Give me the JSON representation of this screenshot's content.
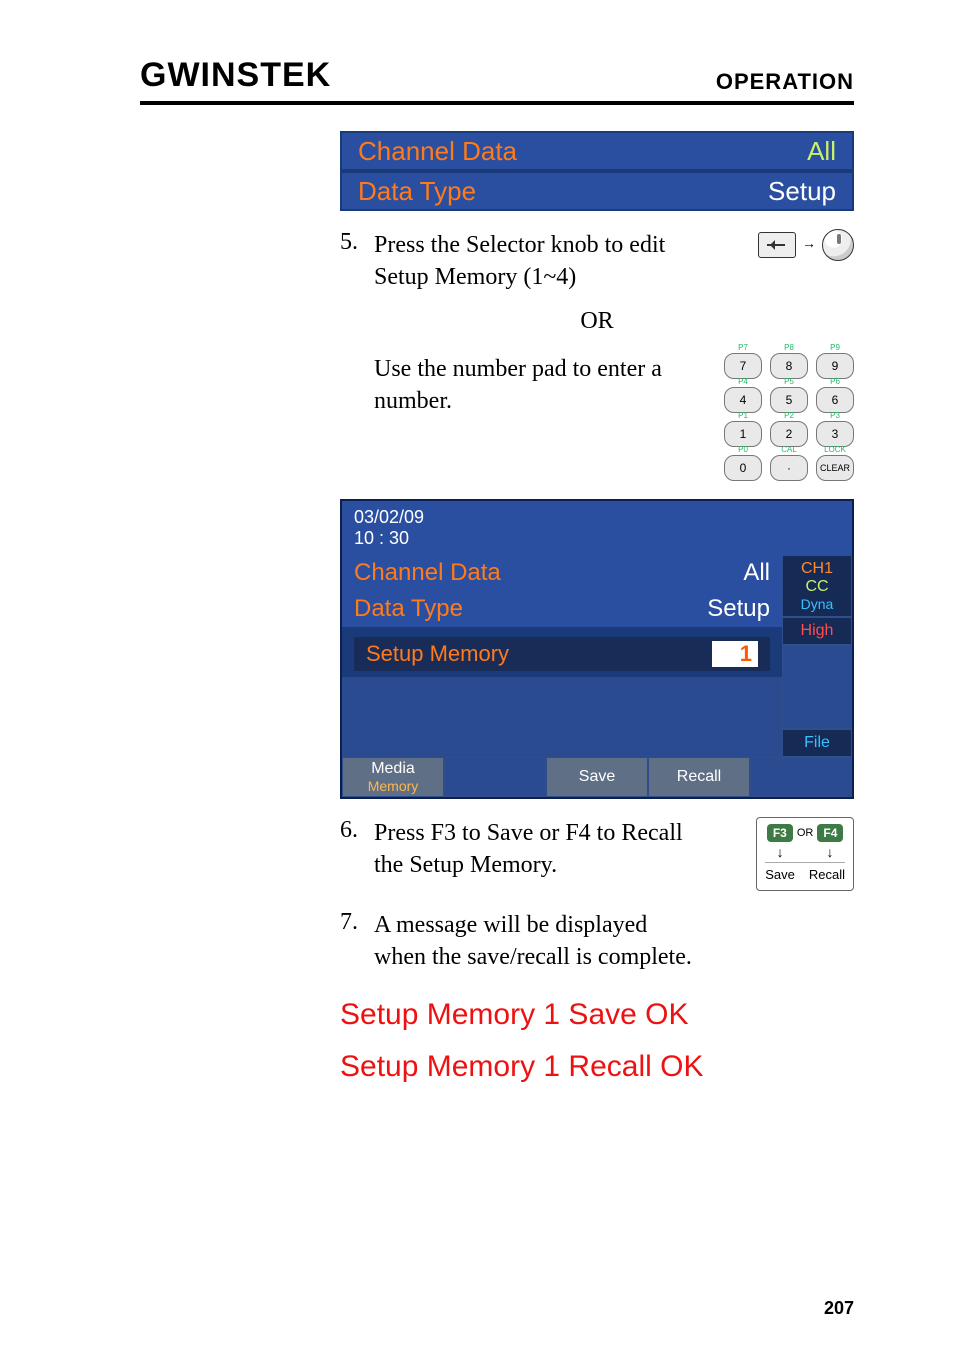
{
  "header": {
    "logo": "GWINSTEK",
    "section": "OPERATION"
  },
  "topbars": {
    "row1_label": "Channel Data",
    "row1_value": "All",
    "row2_label": "Data Type",
    "row2_value": "Setup"
  },
  "step5": {
    "n": "5.",
    "text": "Press the Selector knob to edit Setup Memory (1~4)"
  },
  "or": "OR",
  "step5b": {
    "text": "Use the number pad to enter a number."
  },
  "keypad": {
    "keys": [
      "7",
      "8",
      "9",
      "4",
      "5",
      "6",
      "1",
      "2",
      "3",
      "0",
      "·",
      "CLEAR"
    ],
    "sups": [
      "P7",
      "P8",
      "P9",
      "P4",
      "P5",
      "P6",
      "P1",
      "P2",
      "P3",
      "P0",
      "CAL",
      "LOCK"
    ]
  },
  "device": {
    "date": "03/02/09",
    "time": "10 : 30",
    "row_channel_label": "Channel Data",
    "row_channel_value": "All",
    "row_type_label": "Data Type",
    "row_type_value": "Setup",
    "setup_label": "Setup Memory",
    "setup_value": "1",
    "side": {
      "ch1": "CH1",
      "cc": "CC",
      "dyna": "Dyna",
      "high": "High",
      "file": "File"
    },
    "soft": {
      "media": "Media",
      "memory": "Memory",
      "save": "Save",
      "recall": "Recall"
    }
  },
  "step6": {
    "n": "6.",
    "text": "Press F3 to Save or F4 to Recall the Setup Memory."
  },
  "fkeys": {
    "f3": "F3",
    "or": "OR",
    "f4": "F4",
    "save": "Save",
    "recall": "Recall"
  },
  "step7": {
    "n": "7.",
    "text": "A message will be displayed when the save/recall is complete."
  },
  "msg1": "Setup Memory 1 Save OK",
  "msg2": "Setup Memory 1 Recall OK",
  "pagenum": "207"
}
